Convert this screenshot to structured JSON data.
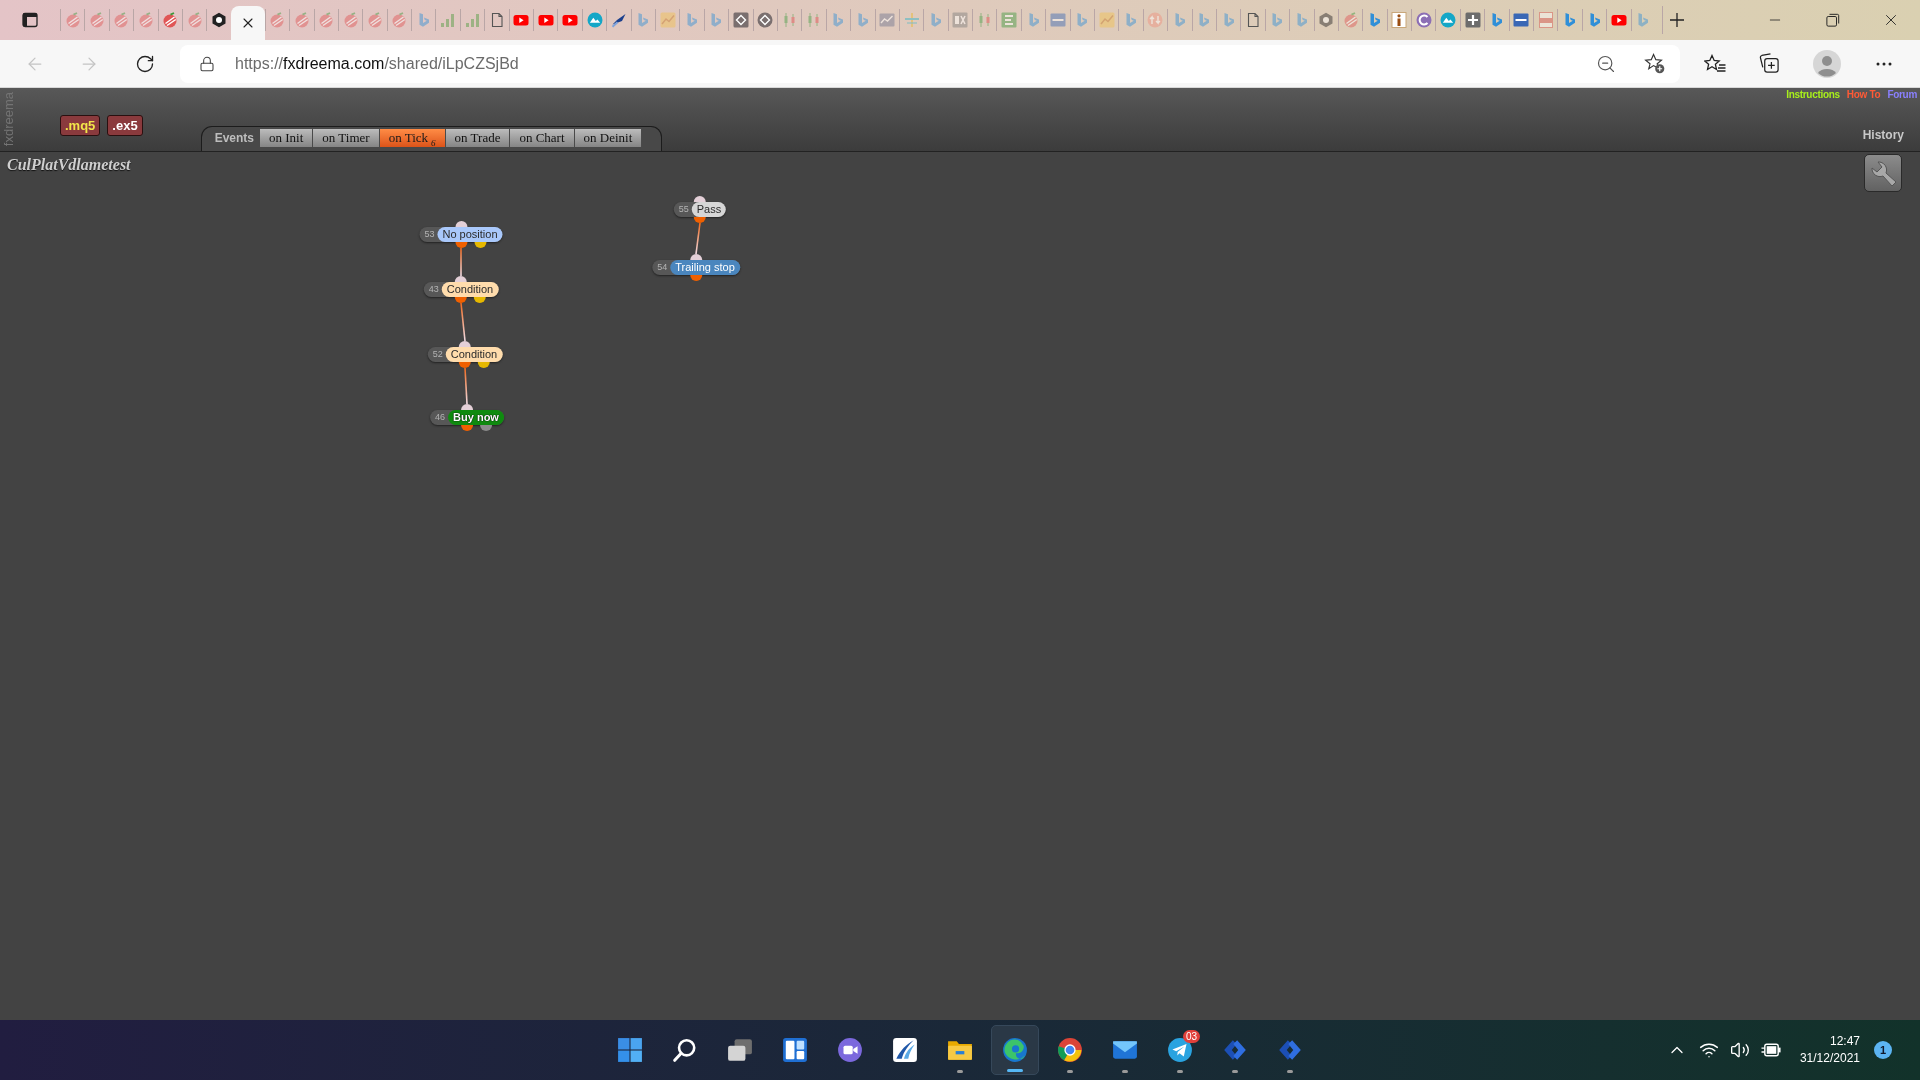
{
  "browser": {
    "tabs": [
      {
        "kind": "tomato",
        "selected": false,
        "asleep": true
      },
      {
        "kind": "tomato",
        "selected": false,
        "asleep": true
      },
      {
        "kind": "tomato",
        "selected": false,
        "asleep": true
      },
      {
        "kind": "tomato",
        "selected": false,
        "asleep": true
      },
      {
        "kind": "tomato",
        "selected": false,
        "asleep": false
      },
      {
        "kind": "tomato",
        "selected": false,
        "asleep": true
      },
      {
        "kind": "hexagon",
        "selected": false,
        "asleep": false
      },
      {
        "selected": true
      },
      {
        "kind": "tomato",
        "selected": false,
        "asleep": true
      },
      {
        "kind": "tomato",
        "selected": false,
        "asleep": true
      },
      {
        "kind": "tomato",
        "selected": false,
        "asleep": true
      },
      {
        "kind": "tomato",
        "selected": false,
        "asleep": true
      },
      {
        "kind": "tomato",
        "selected": false,
        "asleep": true
      },
      {
        "kind": "tomato",
        "selected": false,
        "asleep": true
      },
      {
        "kind": "bing",
        "selected": false,
        "asleep": true
      },
      {
        "kind": "bars",
        "selected": false,
        "asleep": true
      },
      {
        "kind": "bars",
        "selected": false,
        "asleep": true
      },
      {
        "kind": "doc",
        "selected": false,
        "asleep": false
      },
      {
        "kind": "youtube",
        "selected": false,
        "asleep": false
      },
      {
        "kind": "youtube",
        "selected": false,
        "asleep": false
      },
      {
        "kind": "youtube",
        "selected": false,
        "asleep": false
      },
      {
        "kind": "teal",
        "selected": false,
        "asleep": false
      },
      {
        "kind": "plane",
        "selected": false,
        "asleep": false
      },
      {
        "kind": "bing",
        "selected": false,
        "asleep": true
      },
      {
        "kind": "chart",
        "selected": false,
        "asleep": true
      },
      {
        "kind": "bing",
        "selected": false,
        "asleep": true
      },
      {
        "kind": "bing",
        "selected": false,
        "asleep": true
      },
      {
        "kind": "diamond",
        "selected": false,
        "asleep": false
      },
      {
        "kind": "diamond-round",
        "selected": false,
        "asleep": false
      },
      {
        "kind": "candle",
        "selected": false,
        "asleep": true
      },
      {
        "kind": "candle",
        "selected": false,
        "asleep": true
      },
      {
        "kind": "bing",
        "selected": false,
        "asleep": true
      },
      {
        "kind": "bing",
        "selected": false,
        "asleep": true
      },
      {
        "kind": "graph",
        "selected": false,
        "asleep": true
      },
      {
        "kind": "cross",
        "selected": false,
        "asleep": true
      },
      {
        "kind": "bing",
        "selected": false,
        "asleep": true
      },
      {
        "kind": "fx",
        "selected": false,
        "asleep": true
      },
      {
        "kind": "candle",
        "selected": false,
        "asleep": true
      },
      {
        "kind": "e",
        "selected": false,
        "asleep": true
      },
      {
        "kind": "bing",
        "selected": false,
        "asleep": true
      },
      {
        "kind": "mql",
        "selected": false,
        "asleep": true
      },
      {
        "kind": "bing",
        "selected": false,
        "asleep": true
      },
      {
        "kind": "chart",
        "selected": false,
        "asleep": true
      },
      {
        "kind": "bing",
        "selected": false,
        "asleep": true
      },
      {
        "kind": "arrows",
        "selected": false,
        "asleep": true
      },
      {
        "kind": "bing",
        "selected": false,
        "asleep": true
      },
      {
        "kind": "bing",
        "selected": false,
        "asleep": true
      },
      {
        "kind": "bing",
        "selected": false,
        "asleep": true
      },
      {
        "kind": "doc",
        "selected": false,
        "asleep": false
      },
      {
        "kind": "bing",
        "selected": false,
        "asleep": true
      },
      {
        "kind": "bing",
        "selected": false,
        "asleep": true
      },
      {
        "kind": "hexagon",
        "selected": false,
        "asleep": true
      },
      {
        "kind": "tomato",
        "selected": false,
        "asleep": true
      },
      {
        "kind": "bing",
        "selected": false,
        "asleep": false
      },
      {
        "kind": "info",
        "selected": false,
        "asleep": false
      },
      {
        "kind": "crescent",
        "selected": false,
        "asleep": false
      },
      {
        "kind": "teal",
        "selected": false,
        "asleep": false
      },
      {
        "kind": "plus",
        "selected": false,
        "asleep": false
      },
      {
        "kind": "bing",
        "selected": false,
        "asleep": false
      },
      {
        "kind": "mql",
        "selected": false,
        "asleep": false
      },
      {
        "kind": "pdf",
        "selected": false,
        "asleep": true
      },
      {
        "kind": "bing",
        "selected": false,
        "asleep": false
      },
      {
        "kind": "bing",
        "selected": false,
        "asleep": false
      },
      {
        "kind": "youtube",
        "selected": false,
        "asleep": false
      },
      {
        "kind": "bing",
        "selected": false,
        "asleep": true
      }
    ],
    "address": {
      "scheme": "https://",
      "domain": "fxdreema.com",
      "path": "/shared/iLpCZSjBd"
    }
  },
  "header": {
    "logo": "fxdreema",
    "file_buttons": [
      {
        "label": ".mq5",
        "color": "#f2e64a"
      },
      {
        "label": ".ex5",
        "color": "#ffffff"
      }
    ],
    "events_label": "Events",
    "event_tabs": [
      {
        "label": "on Init",
        "selected": false
      },
      {
        "label": "on Timer",
        "selected": false
      },
      {
        "label": "on Tick",
        "selected": true,
        "count": "6"
      },
      {
        "label": "on Trade",
        "selected": false
      },
      {
        "label": "on Chart",
        "selected": false
      },
      {
        "label": "on Deinit",
        "selected": false
      }
    ],
    "links": [
      {
        "label": "Instructions",
        "color": "#a8f01c"
      },
      {
        "label": "How To",
        "color": "#ff5a36"
      },
      {
        "label": "Forum",
        "color": "#8a80ff"
      }
    ],
    "history": "History"
  },
  "canvas": {
    "project": "CulPlatVdlametest",
    "flows": [
      {
        "number": "53",
        "label": "No position",
        "kind": "plain",
        "color": "#a9c8fb",
        "outputs": [
          {
            "color": "#f06000"
          },
          {
            "color": "#e6b800"
          }
        ],
        "children": [
          {
            "number": "43",
            "label": "Condition",
            "kind": "plain",
            "color": "#ffdcac",
            "outputs": [
              {
                "color": "#f06000"
              },
              {
                "color": "#e6b800"
              }
            ],
            "children": [
              {
                "number": "52",
                "label": "Condition",
                "kind": "plain",
                "color": "#ffdcac",
                "outputs": [
                  {
                    "color": "#f06000"
                  },
                  {
                    "color": "#e6b800"
                  }
                ],
                "children": [
                  {
                    "number": "46",
                    "label": "Buy now",
                    "kind": "outlined",
                    "color": "#0f8a0f",
                    "outputs": [
                      {
                        "color": "#f06000"
                      },
                      {
                        "color": "#8a8a8a"
                      }
                    ]
                  }
                ]
              }
            ]
          }
        ]
      },
      {
        "number": "55",
        "label": "Pass",
        "kind": "plain",
        "color": "#d6d6d6",
        "outputs": [
          {
            "color": "#f06000"
          }
        ],
        "children": [
          {
            "number": "54",
            "label": "Trailing stop",
            "kind": "plain",
            "color": "#4a86be",
            "outputs": [
              {
                "color": "#f06000"
              }
            ]
          }
        ]
      }
    ]
  },
  "taskbar": {
    "apps": [
      {
        "kind": "start",
        "running": false,
        "selected": false
      },
      {
        "kind": "search",
        "running": false,
        "selected": false
      },
      {
        "kind": "taskview",
        "running": false,
        "selected": false
      },
      {
        "kind": "widgets",
        "running": false,
        "selected": false
      },
      {
        "kind": "chat",
        "running": false,
        "selected": false
      },
      {
        "kind": "swoosh",
        "running": false,
        "selected": false
      },
      {
        "kind": "folder",
        "running": true,
        "selected": false
      },
      {
        "kind": "edge",
        "running": true,
        "selected": true
      },
      {
        "kind": "chrome",
        "running": true,
        "selected": false
      },
      {
        "kind": "mail",
        "running": true,
        "selected": false
      },
      {
        "kind": "telegram",
        "running": true,
        "selected": false,
        "badge": "03"
      },
      {
        "kind": "chevrons",
        "running": true,
        "selected": false
      },
      {
        "kind": "chevrons",
        "running": true,
        "selected": false
      }
    ],
    "clock": {
      "time": "12:47",
      "date": "31/12/2021"
    },
    "notifications": "1"
  }
}
